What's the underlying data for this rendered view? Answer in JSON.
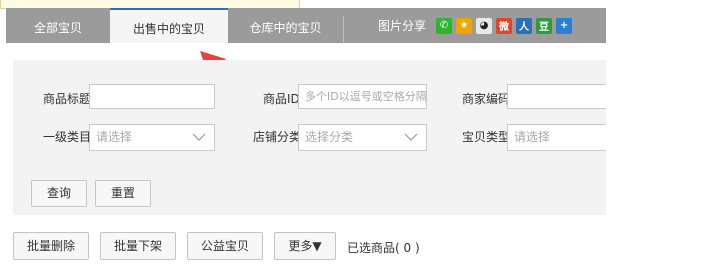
{
  "tabs": [
    {
      "label": "全部宝贝"
    },
    {
      "label": "出售中的宝贝"
    },
    {
      "label": "仓库中的宝贝"
    }
  ],
  "share": {
    "label": "图片分享",
    "icons": [
      "wechat-icon",
      "qzone-icon",
      "qq-icon",
      "weibo-icon",
      "renren-icon",
      "douban-icon",
      "more-share-icon"
    ],
    "icon_glyphs": [
      "✆",
      "★",
      "◕",
      "微",
      "人",
      "豆",
      "+"
    ],
    "icon_colors": [
      "#2db52d",
      "#f0a500",
      "#e8e8e8",
      "#e0452b",
      "#2a6fbb",
      "#2f9b3a",
      "#2a7fd4"
    ]
  },
  "filters": {
    "title_label": "商品标题",
    "title_value": "",
    "id_label": "商品ID",
    "id_placeholder": "多个ID以逗号或空格分隔",
    "merchant_code_label": "商家编码",
    "merchant_code_value": "",
    "category_label": "一级类目",
    "category_placeholder": "请选择",
    "store_category_label": "店铺分类",
    "store_category_placeholder": "选择分类",
    "item_type_label": "宝贝类型",
    "item_type_placeholder": "请选择"
  },
  "actions": {
    "query": "查询",
    "reset": "重置"
  },
  "bulk": {
    "delete": "批量删除",
    "delist": "批量下架",
    "charity": "公益宝贝",
    "more": "更多▼",
    "selected": "已选商品( 0 )"
  },
  "colors": {
    "tabbar": "#9b9b9b",
    "active_tab_border": "#2a6fbb",
    "arrow": "#e8413a"
  }
}
